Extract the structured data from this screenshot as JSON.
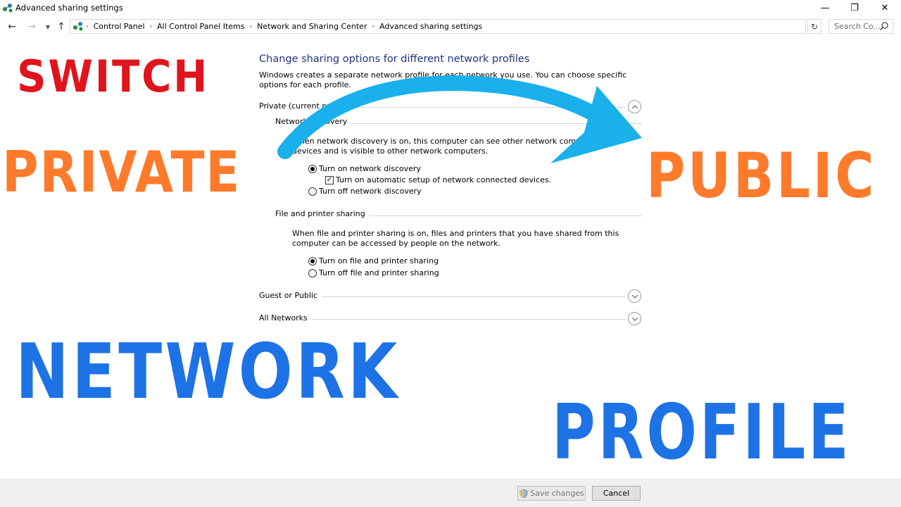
{
  "window": {
    "title": "Advanced sharing settings",
    "controls": {
      "minimize": "—",
      "maximize": "❐",
      "close": "✕"
    }
  },
  "address_bar": {
    "breadcrumbs": [
      "Control Panel",
      "All Control Panel Items",
      "Network and Sharing Center",
      "Advanced sharing settings"
    ],
    "search_placeholder": "Search Co..."
  },
  "main": {
    "heading": "Change sharing options for different network profiles",
    "intro": "Windows creates a separate network profile for each network you use. You can choose specific options for each profile.",
    "profiles": {
      "private": {
        "label": "Private (current profile)",
        "network_discovery": {
          "title": "Network discovery",
          "description": "When network discovery is on, this computer can see other network computers and devices and is visible to other network computers.",
          "option_on": "Turn on network discovery",
          "option_auto_setup": "Turn on automatic setup of network connected devices.",
          "option_off": "Turn off network discovery",
          "selected": "on",
          "auto_setup_checked": true
        },
        "file_printer_sharing": {
          "title": "File and printer sharing",
          "description": "When file and printer sharing is on, files and printers that you have shared from this computer can be accessed by people on the network.",
          "option_on": "Turn on file and printer sharing",
          "option_off": "Turn off file and printer sharing",
          "selected": "on"
        }
      },
      "guest_public": {
        "label": "Guest or Public"
      },
      "all_networks": {
        "label": "All Networks"
      }
    }
  },
  "footer": {
    "save_label": "Save changes",
    "cancel_label": "Cancel"
  },
  "overlay": {
    "switch": "SWITCH",
    "private": "PRIVATE",
    "public": "PUBLIC",
    "network": "NETWORK",
    "profile": "PROFILE",
    "colors": {
      "red": "#e0141c",
      "orange": "#ff7a2a",
      "blue": "#1d72e6",
      "arrow": "#1ab0ec"
    }
  }
}
